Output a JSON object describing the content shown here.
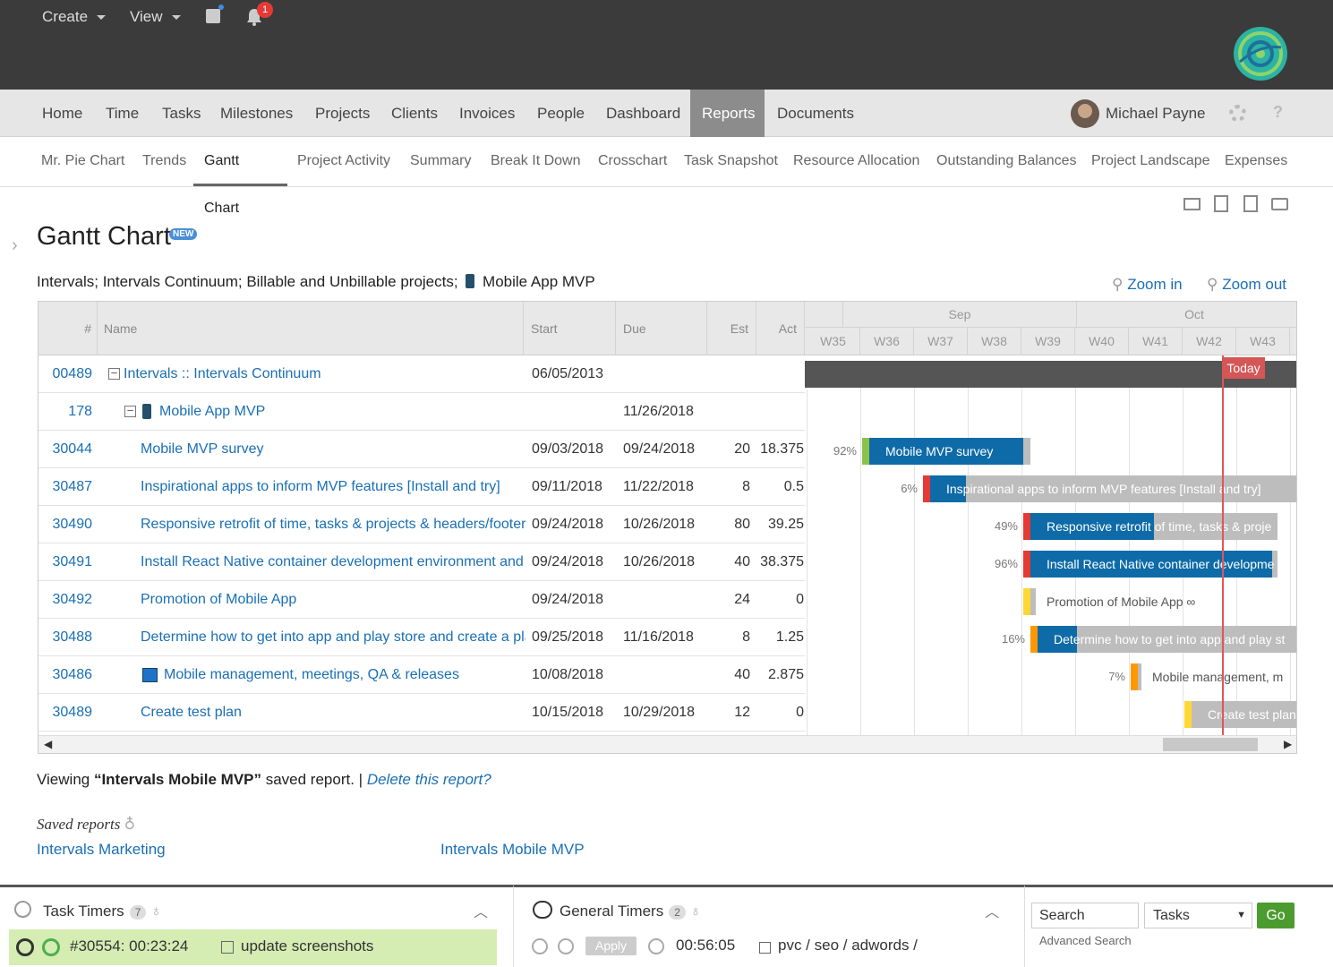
{
  "topbar": {
    "create": "Create",
    "view": "View",
    "notification_count": "1"
  },
  "nav": {
    "items": [
      "Home",
      "Time",
      "Tasks",
      "Milestones",
      "Projects",
      "Clients",
      "Invoices",
      "People",
      "Dashboard",
      "Reports",
      "Documents"
    ],
    "active": "Reports",
    "user_name": "Michael Payne"
  },
  "subnav": {
    "items": [
      "Mr. Pie Chart",
      "Trends",
      "Gantt Chart",
      "Project Activity",
      "Summary",
      "Break It Down",
      "Crosschart",
      "Task Snapshot",
      "Resource Allocation",
      "Outstanding Balances",
      "Project Landscape",
      "Expenses"
    ],
    "active": "Gantt Chart"
  },
  "page": {
    "title": "Gantt Chart",
    "new_badge": "NEW",
    "filter_text": "Intervals; Intervals Continuum; Billable and Unbillable projects;",
    "filter_project": "Mobile App MVP",
    "zoom_in": "Zoom in",
    "zoom_out": "Zoom out"
  },
  "grid": {
    "headers": {
      "num": "#",
      "name": "Name",
      "start": "Start",
      "due": "Due",
      "est": "Est",
      "act": "Act"
    },
    "months": [
      "Sep",
      "Oct"
    ],
    "weeks": [
      "W35",
      "W36",
      "W37",
      "W38",
      "W39",
      "W40",
      "W41",
      "W42",
      "W43"
    ],
    "today_label": "Today",
    "rows": [
      {
        "id": "00489",
        "name": "Intervals :: Intervals Continuum",
        "start": "06/05/2013",
        "due": "",
        "est": "",
        "act": ""
      },
      {
        "id": "178",
        "name": "Mobile App MVP",
        "start": "",
        "due": "11/26/2018",
        "est": "",
        "act": ""
      },
      {
        "id": "30044",
        "name": "Mobile MVP survey",
        "start": "09/03/2018",
        "due": "09/24/2018",
        "est": "20",
        "act": "18.375"
      },
      {
        "id": "30487",
        "name": "Inspirational apps to inform MVP features [Install and try]",
        "start": "09/11/2018",
        "due": "11/22/2018",
        "est": "8",
        "act": "0.5"
      },
      {
        "id": "30490",
        "name": "Responsive retrofit of time, tasks & projects & headers/footers",
        "start": "09/24/2018",
        "due": "10/26/2018",
        "est": "80",
        "act": "39.25"
      },
      {
        "id": "30491",
        "name": "Install React Native container development environment and in",
        "start": "09/24/2018",
        "due": "10/26/2018",
        "est": "40",
        "act": "38.375"
      },
      {
        "id": "30492",
        "name": "Promotion of Mobile App",
        "start": "09/24/2018",
        "due": "",
        "est": "24",
        "act": "0"
      },
      {
        "id": "30488",
        "name": "Determine how to get into app and play store and create a pla",
        "start": "09/25/2018",
        "due": "11/16/2018",
        "est": "8",
        "act": "1.25"
      },
      {
        "id": "30486",
        "name": "Mobile management, meetings, QA & releases",
        "start": "10/08/2018",
        "due": "",
        "est": "40",
        "act": "2.875"
      },
      {
        "id": "30489",
        "name": "Create test plan",
        "start": "10/15/2018",
        "due": "10/29/2018",
        "est": "12",
        "act": "0"
      }
    ],
    "bars": [
      {
        "pct": "92%",
        "label": "Mobile MVP survey"
      },
      {
        "pct": "6%",
        "label": "Inspirational apps to inform MVP features [Install and try]"
      },
      {
        "pct": "49%",
        "label": "Responsive retrofit of time, tasks & proje"
      },
      {
        "pct": "96%",
        "label": "Install React Native container developme"
      },
      {
        "pct": "",
        "label": "Promotion of Mobile App ∞"
      },
      {
        "pct": "16%",
        "label": "Determine how to get into app and play st"
      },
      {
        "pct": "7%",
        "label": "Mobile management, m"
      },
      {
        "pct": "",
        "label": "Create test plan"
      }
    ]
  },
  "viewing": {
    "prefix": "Viewing ",
    "report": "“Intervals Mobile MVP”",
    "suffix": " saved report. |",
    "delete": "Delete this report?"
  },
  "saved": {
    "label": "Saved reports",
    "items": [
      "Intervals Marketing",
      "Intervals Mobile MVP"
    ]
  },
  "footer": {
    "task_timers": "Task Timers",
    "task_timers_count": "7",
    "task_timer_entry": "#30554: 00:23:24",
    "task_timer_desc": "update screenshots",
    "general_timers": "General Timers",
    "general_timers_count": "2",
    "apply": "Apply",
    "general_time": "00:56:05",
    "general_desc": "pvc / seo / adwords /",
    "search_value": "Search",
    "search_type": "Tasks",
    "go": "Go",
    "advanced": "Advanced Search"
  }
}
